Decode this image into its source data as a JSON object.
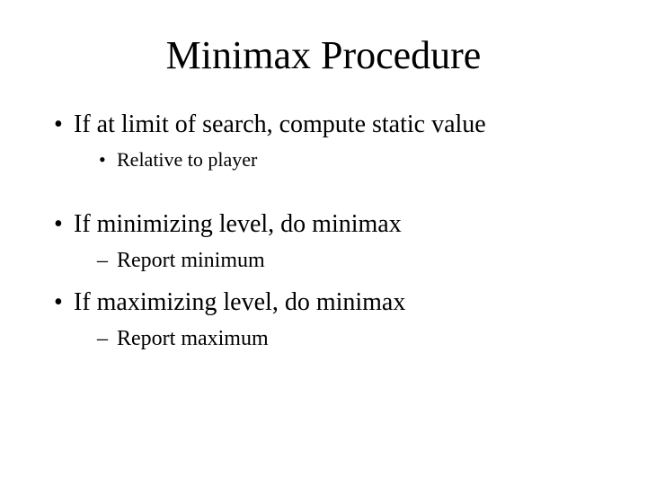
{
  "slide": {
    "title": "Minimax Procedure",
    "items": [
      {
        "text": "If at limit of search, compute static value",
        "sub": {
          "style": "dot",
          "text": "Relative to player"
        }
      },
      {
        "text": "If minimizing level, do minimax",
        "sub": {
          "style": "dash",
          "text": "Report minimum"
        }
      },
      {
        "text": "If maximizing level, do minimax",
        "sub": {
          "style": "dash",
          "text": "Report maximum"
        }
      }
    ]
  }
}
